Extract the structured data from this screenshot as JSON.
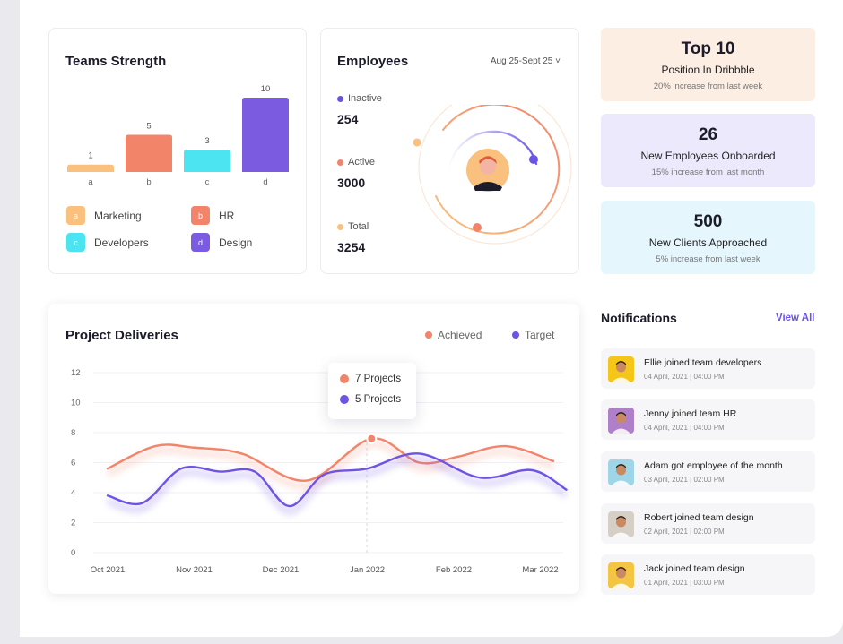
{
  "teams": {
    "title": "Teams Strength",
    "legend": [
      {
        "key": "a",
        "label": "Marketing",
        "color": "#f9c07e"
      },
      {
        "key": "b",
        "label": "HR",
        "color": "#f2846a"
      },
      {
        "key": "c",
        "label": "Developers",
        "color": "#4de4f2"
      },
      {
        "key": "d",
        "label": "Design",
        "color": "#7b5be0"
      }
    ]
  },
  "chart_data": [
    {
      "type": "bar",
      "title": "Teams Strength",
      "categories": [
        "a",
        "b",
        "c",
        "d"
      ],
      "values": [
        1,
        5,
        3,
        10
      ],
      "colors": [
        "#f9c07e",
        "#f2846a",
        "#4de4f2",
        "#7b5be0"
      ],
      "ylim": [
        0,
        10
      ]
    },
    {
      "type": "line",
      "title": "Project Deliveries",
      "x": [
        "Oct 2021",
        "Nov 2021",
        "Dec 2021",
        "Jan 2022",
        "Feb 2022",
        "Mar 2022"
      ],
      "ylim": [
        0,
        12
      ],
      "yticks": [
        0,
        2,
        4,
        6,
        8,
        10,
        12
      ],
      "grid": true,
      "legend_position": "top-right",
      "series": [
        {
          "name": "Achieved",
          "color": "#f2846a",
          "x": [
            0,
            0.55,
            1,
            1.55,
            2.3,
            3.05,
            3.6,
            4.05,
            4.6,
            5.15
          ],
          "values": [
            5.6,
            7.1,
            7.0,
            6.6,
            4.8,
            7.6,
            6.0,
            6.4,
            7.1,
            6.1
          ]
        },
        {
          "name": "Target",
          "color": "#6f53e4",
          "x": [
            0,
            0.4,
            0.85,
            1.3,
            1.7,
            2.1,
            2.5,
            3.0,
            3.6,
            4.3,
            4.9,
            5.3
          ],
          "values": [
            3.8,
            3.3,
            5.6,
            5.4,
            5.4,
            3.1,
            5.2,
            5.6,
            6.6,
            5.0,
            5.5,
            4.2
          ]
        }
      ],
      "tooltip": {
        "x": "Jan 2022",
        "achieved_label": "7 Projects",
        "target_label": "5 Projects"
      }
    }
  ],
  "employees": {
    "title": "Employees",
    "date_range": "Aug 25-Sept 25 ˅",
    "stats": [
      {
        "label": "Inactive",
        "value": "254",
        "color": "#6a53e6"
      },
      {
        "label": "Active",
        "value": "3000",
        "color": "#f2846a"
      },
      {
        "label": "Total",
        "value": "3254",
        "color": "#f9c07e"
      }
    ]
  },
  "stats": [
    {
      "big": "Top 10",
      "mid": "Position In Dribbble",
      "small": "20% increase from last week",
      "bg": "#fdeee3"
    },
    {
      "big": "26",
      "mid": "New Employees Onboarded",
      "small": "15% increase from last month",
      "bg": "#ece9fd"
    },
    {
      "big": "500",
      "mid": "New Clients Approached",
      "small": "5% increase from last week",
      "bg": "#e5f6fd"
    }
  ],
  "deliveries": {
    "title": "Project Deliveries",
    "legend_achieved": "Achieved",
    "legend_target": "Target"
  },
  "notifications": {
    "title": "Notifications",
    "view_all": "View All",
    "items": [
      {
        "text": "Ellie joined team developers",
        "time": "04 April, 2021 | 04:00 PM",
        "avatar_bg": "#f5c518"
      },
      {
        "text": "Jenny joined team HR",
        "time": "04 April, 2021 | 04:00 PM",
        "avatar_bg": "#b07fc9"
      },
      {
        "text": "Adam got employee of the month",
        "time": "03 April, 2021 | 02:00 PM",
        "avatar_bg": "#9ed6e8"
      },
      {
        "text": "Robert joined team design",
        "time": "02 April, 2021 | 02:00 PM",
        "avatar_bg": "#d6cfc5"
      },
      {
        "text": "Jack joined team design",
        "time": "01 April, 2021 | 03:00 PM",
        "avatar_bg": "#f4c542"
      }
    ]
  }
}
